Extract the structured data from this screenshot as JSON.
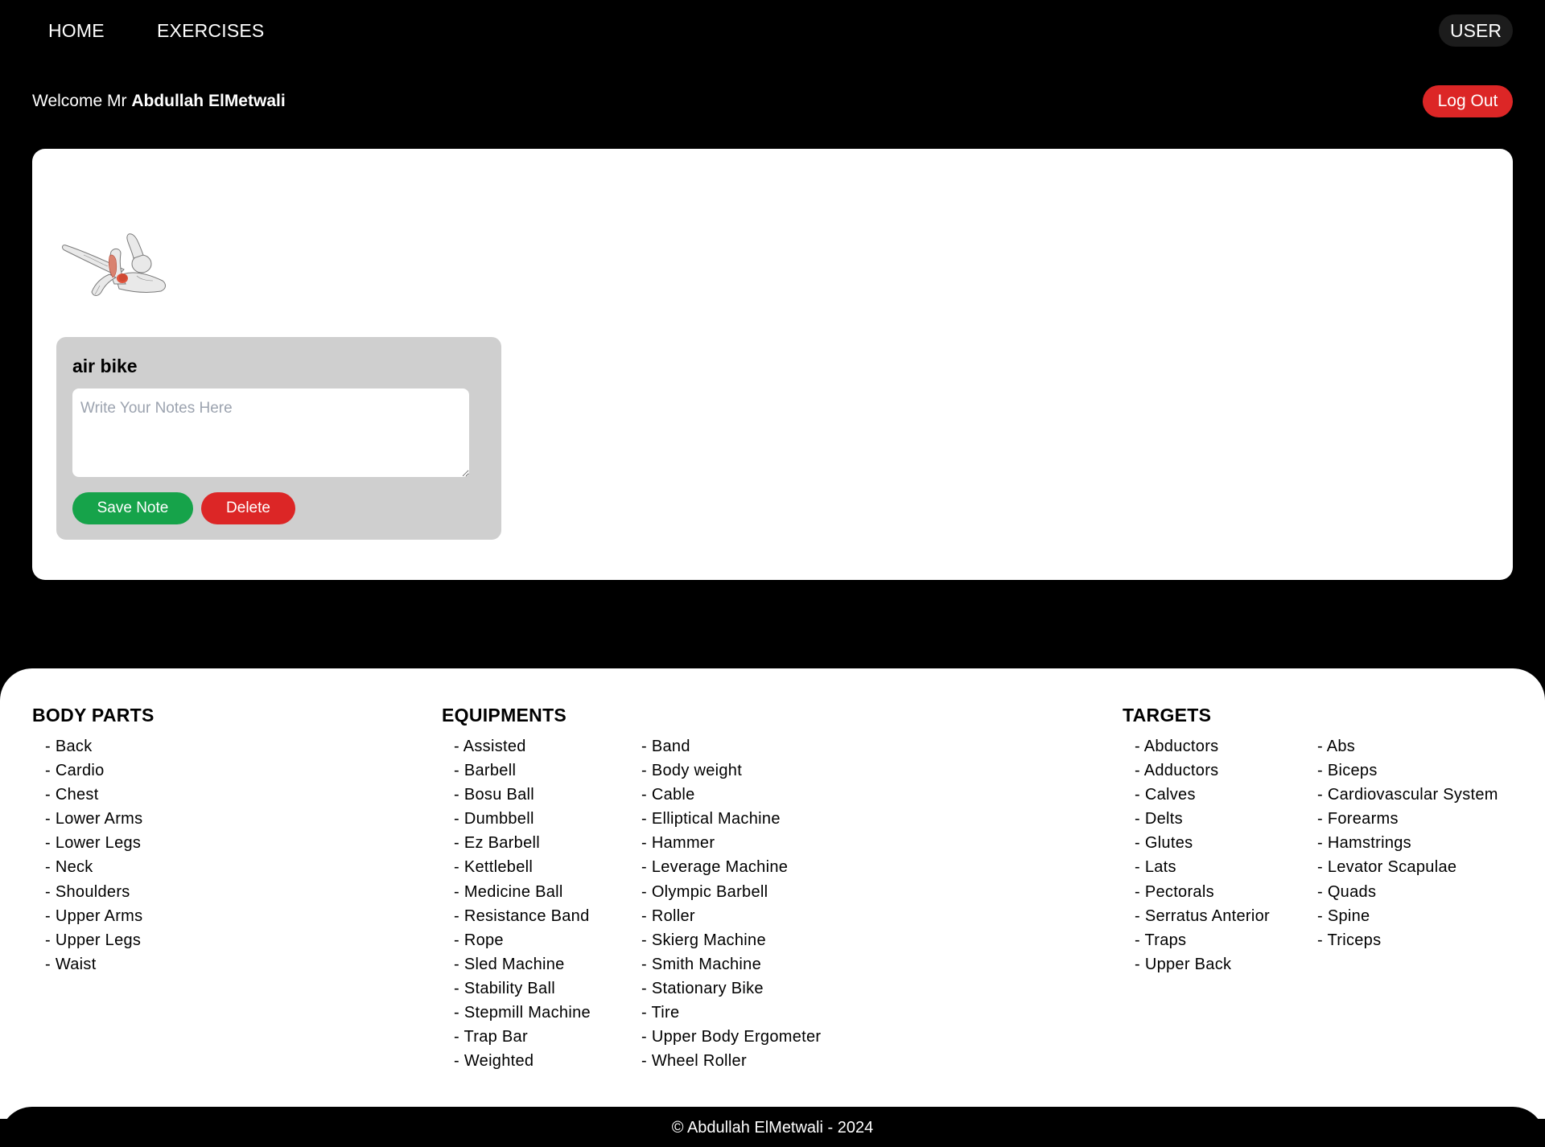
{
  "nav": {
    "home_label": "HOME",
    "exercises_label": "EXERCISES",
    "user_label": "USER"
  },
  "welcome": {
    "prefix": "Welcome Mr",
    "name": "Abdullah ElMetwali",
    "logout_label": "Log Out"
  },
  "exercise": {
    "name": "air bike",
    "notes_value": "",
    "notes_placeholder": "Write Your Notes Here",
    "save_label": "Save Note",
    "delete_label": "Delete"
  },
  "footer": {
    "body_parts": {
      "title": "BODY PARTS",
      "items": [
        "Back",
        "Cardio",
        "Chest",
        "Lower Arms",
        "Lower Legs",
        "Neck",
        "Shoulders",
        "Upper Arms",
        "Upper Legs",
        "Waist"
      ]
    },
    "equipments": {
      "title": "EQUIPMENTS",
      "items_col1": [
        "Assisted",
        "Barbell",
        "Bosu Ball",
        "Dumbbell",
        "Ez Barbell",
        "Kettlebell",
        "Medicine Ball",
        "Resistance Band",
        "Rope",
        "Sled Machine",
        "Stability Ball",
        "Stepmill Machine",
        "Trap Bar",
        "Weighted"
      ],
      "items_col2": [
        "Band",
        "Body weight",
        "Cable",
        "Elliptical Machine",
        "Hammer",
        "Leverage Machine",
        "Olympic Barbell",
        "Roller",
        "Skierg Machine",
        "Smith Machine",
        "Stationary Bike",
        "Tire",
        "Upper Body Ergometer",
        "Wheel Roller"
      ]
    },
    "targets": {
      "title": "TARGETS",
      "items_col1": [
        "Abductors",
        "Adductors",
        "Calves",
        "Delts",
        "Glutes",
        "Lats",
        "Pectorals",
        "Serratus Anterior",
        "Traps",
        "Upper Back"
      ],
      "items_col2": [
        "Abs",
        "Biceps",
        "Cardiovascular System",
        "Forearms",
        "Hamstrings",
        "Levator Scapulae",
        "Quads",
        "Spine",
        "Triceps"
      ]
    },
    "copyright": "© Abdullah ElMetwali - 2024"
  }
}
